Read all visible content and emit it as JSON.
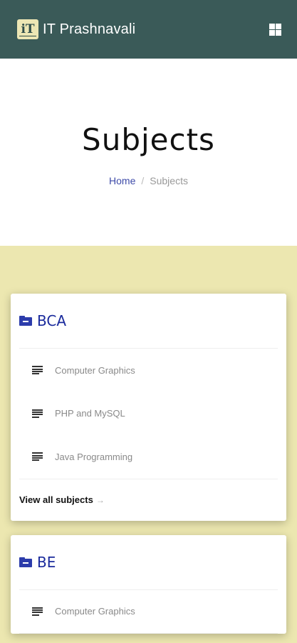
{
  "header": {
    "logo_text": "iT",
    "title": "IT Prashnavali"
  },
  "hero": {
    "title": "Subjects",
    "breadcrumb": {
      "home": "Home",
      "separator": "/",
      "current": "Subjects"
    }
  },
  "colors": {
    "topbar": "#3a5a58",
    "content_bg": "#ece7b0",
    "accent": "#2c3cab"
  },
  "cards": [
    {
      "title": "BCA",
      "icon": "folder-icon",
      "subjects": [
        {
          "label": "Computer Graphics",
          "icon": "lines-icon"
        },
        {
          "label": "PHP and MySQL",
          "icon": "lines-icon"
        },
        {
          "label": "Java Programming",
          "icon": "lines-icon"
        }
      ],
      "view_all": "View all subjects",
      "view_all_arrow": "→"
    },
    {
      "title": "BE",
      "icon": "folder-icon",
      "subjects": [
        {
          "label": "Computer Graphics",
          "icon": "lines-icon"
        }
      ]
    }
  ]
}
